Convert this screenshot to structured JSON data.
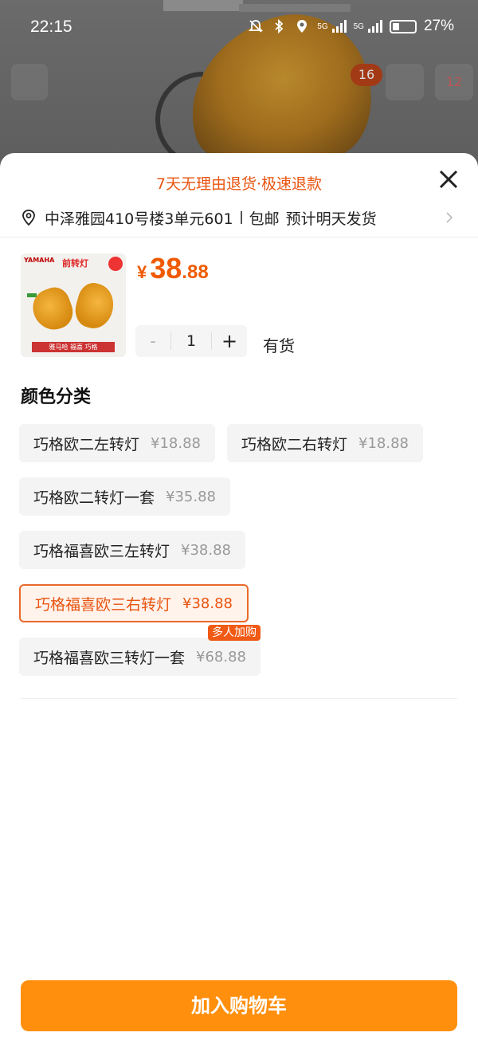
{
  "status_bar": {
    "time": "22:15",
    "battery": "27%",
    "signal1": "5G",
    "signal2": "5G"
  },
  "background": {
    "badge_1": "16",
    "badge_2": "12"
  },
  "sheet": {
    "promo": "7天无理由退货·极速退款",
    "address": "中泽雅园410号楼3单元601",
    "shipping": "包邮",
    "delivery": "预计明天发货"
  },
  "product": {
    "image_brand": "YAMAHA",
    "image_title": "前转灯",
    "image_footer": "雅马哈 福喜 巧格",
    "price_symbol": "¥",
    "price_int": "38",
    "price_dec": ".88",
    "quantity": "1",
    "minus": "-",
    "plus": "+",
    "stock": "有货"
  },
  "variants": {
    "title": "颜色分类",
    "items": [
      {
        "name": "巧格欧二左转灯",
        "price": "¥18.88"
      },
      {
        "name": "巧格欧二右转灯",
        "price": "¥18.88"
      },
      {
        "name": "巧格欧二转灯一套",
        "price": "¥35.88"
      },
      {
        "name": "巧格福喜欧三左转灯",
        "price": "¥38.88"
      },
      {
        "name": "巧格福喜欧三右转灯",
        "price": "¥38.88",
        "selected": true
      },
      {
        "name": "巧格福喜欧三转灯一套",
        "price": "¥68.88",
        "badge": "多人加购"
      }
    ]
  },
  "actions": {
    "add_to_cart": "加入购物车"
  },
  "colors": {
    "accent": "#e8540f",
    "cart_button": "#ff8f0d",
    "price": "#f05a00"
  }
}
